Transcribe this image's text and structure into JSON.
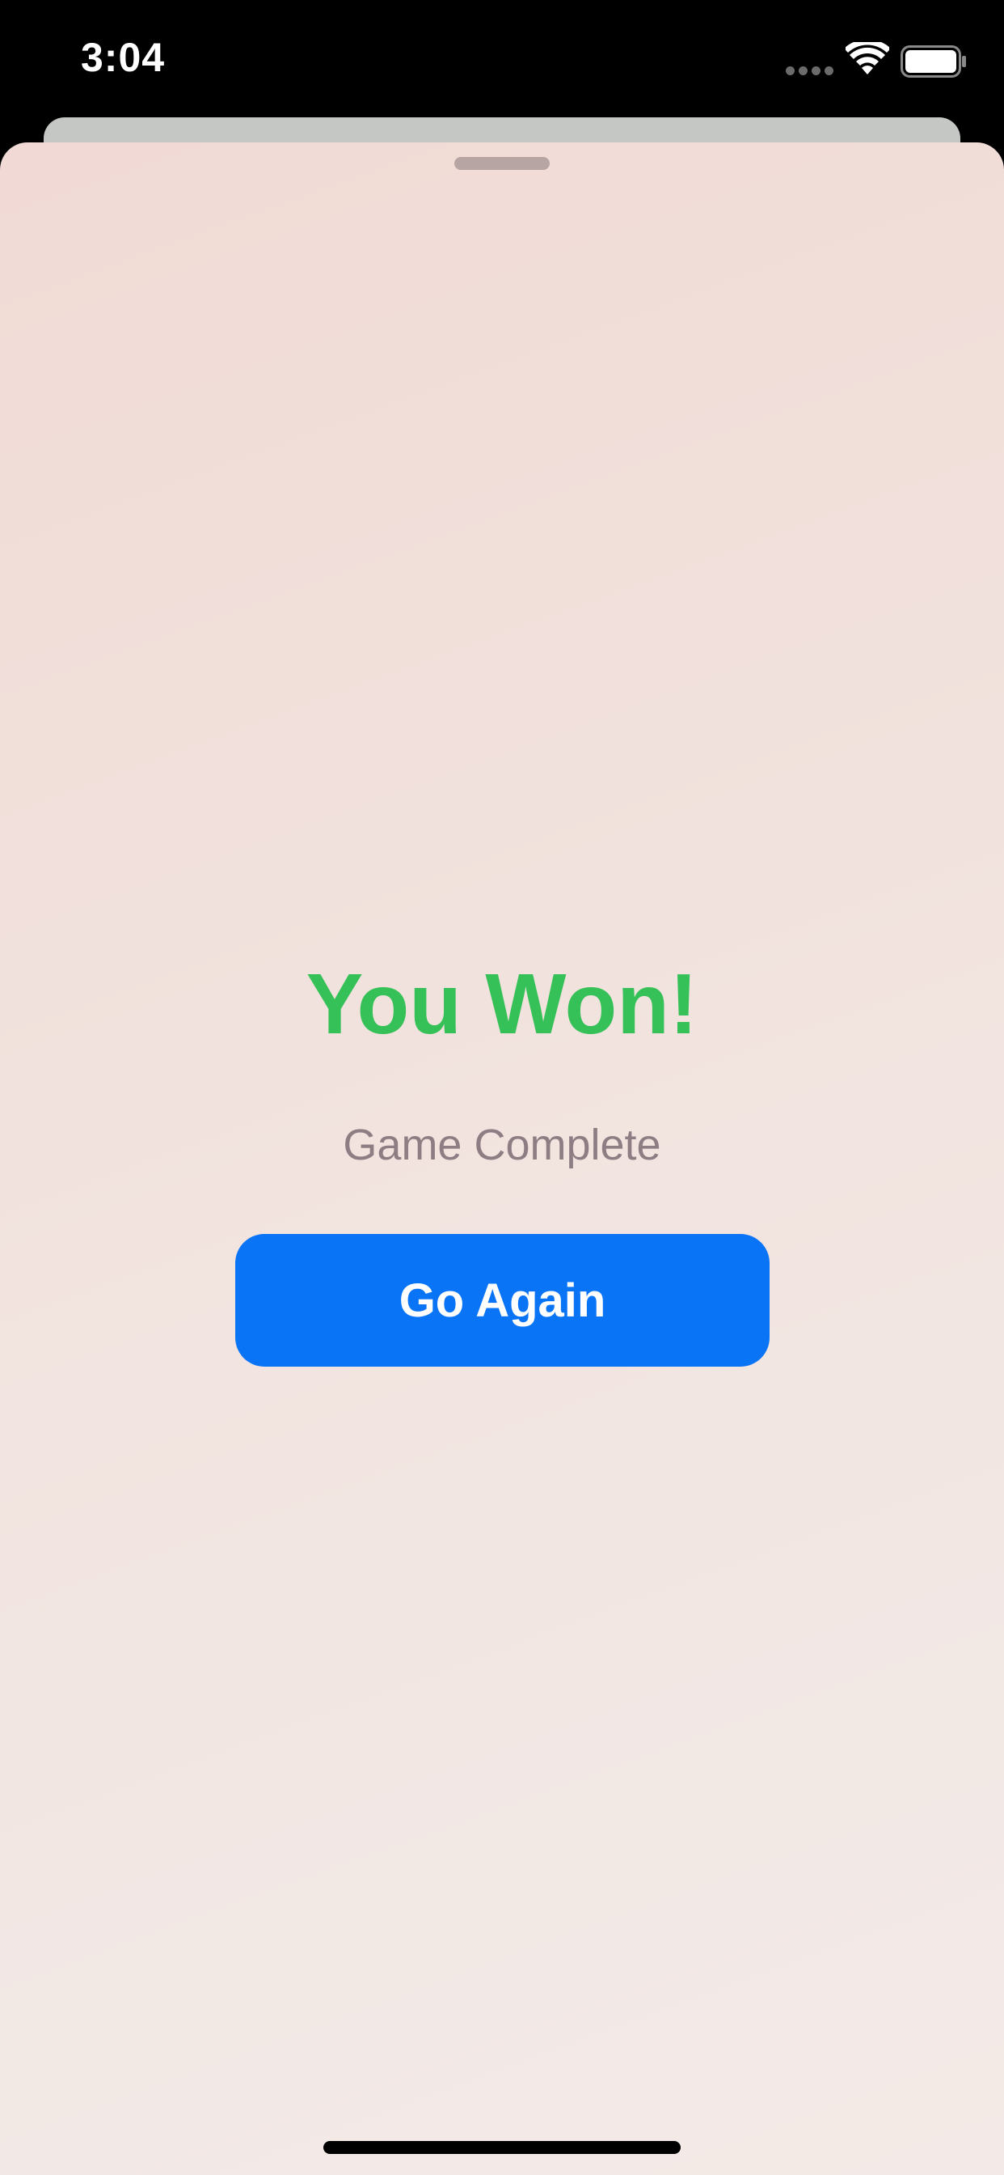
{
  "status_bar": {
    "time": "3:04",
    "icons": [
      "signal-dots-icon",
      "wifi-icon",
      "battery-icon"
    ]
  },
  "sheet": {
    "title": "You Won!",
    "subtitle": "Game Complete",
    "primary_button_label": "Go Again"
  },
  "colors": {
    "title": "#36c158",
    "subtitle": "#8e7e84",
    "button": "#0a74f6",
    "background_start": "#f1dad5",
    "background_end": "#f3eae7"
  }
}
